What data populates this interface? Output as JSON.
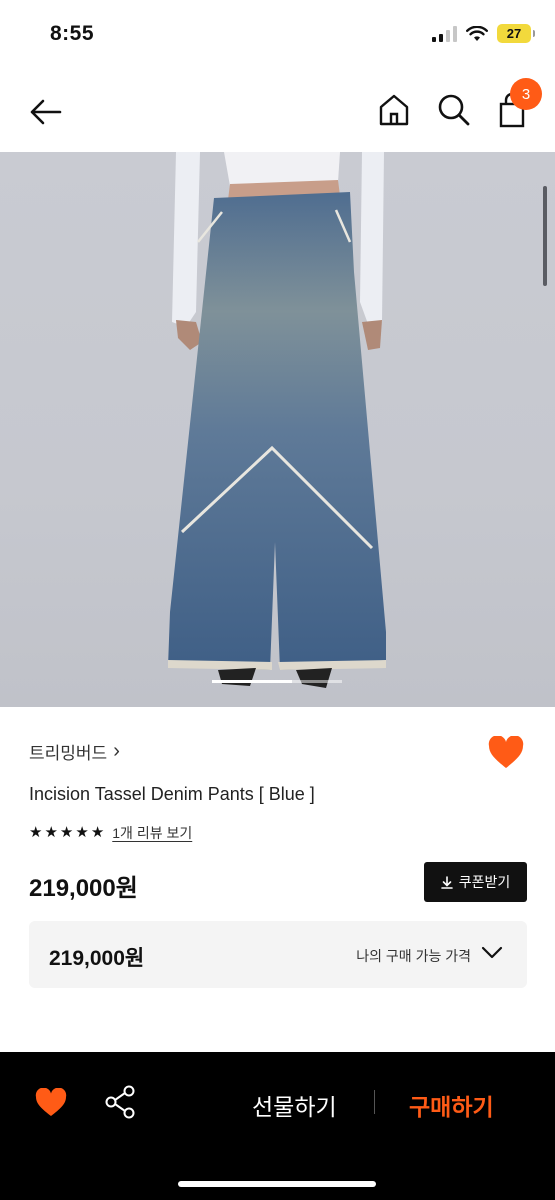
{
  "status_bar": {
    "time": "8:55",
    "battery": "27"
  },
  "nav": {
    "cart_count": "3"
  },
  "product": {
    "brand": "트리밍버드",
    "brand_chevron": "›",
    "name": "Incision Tassel Denim Pants [ Blue ]",
    "stars": 5,
    "review_link": "1개 리뷰 보기",
    "price": "219,000원",
    "coupon_button": "쿠폰받기",
    "my_price": "219,000원",
    "my_price_label": "나의 구매 가능 가격"
  },
  "bottom_bar": {
    "gift_label": "선물하기",
    "buy_label": "구매하기"
  },
  "colors": {
    "accent": "#ff5b16",
    "dark": "#111111",
    "bar": "#000000"
  },
  "icons": [
    "back-arrow-icon",
    "home-icon",
    "search-icon",
    "shopping-bag-icon",
    "heart-icon",
    "star-icon",
    "download-icon",
    "chevron-down-icon",
    "share-icon"
  ]
}
